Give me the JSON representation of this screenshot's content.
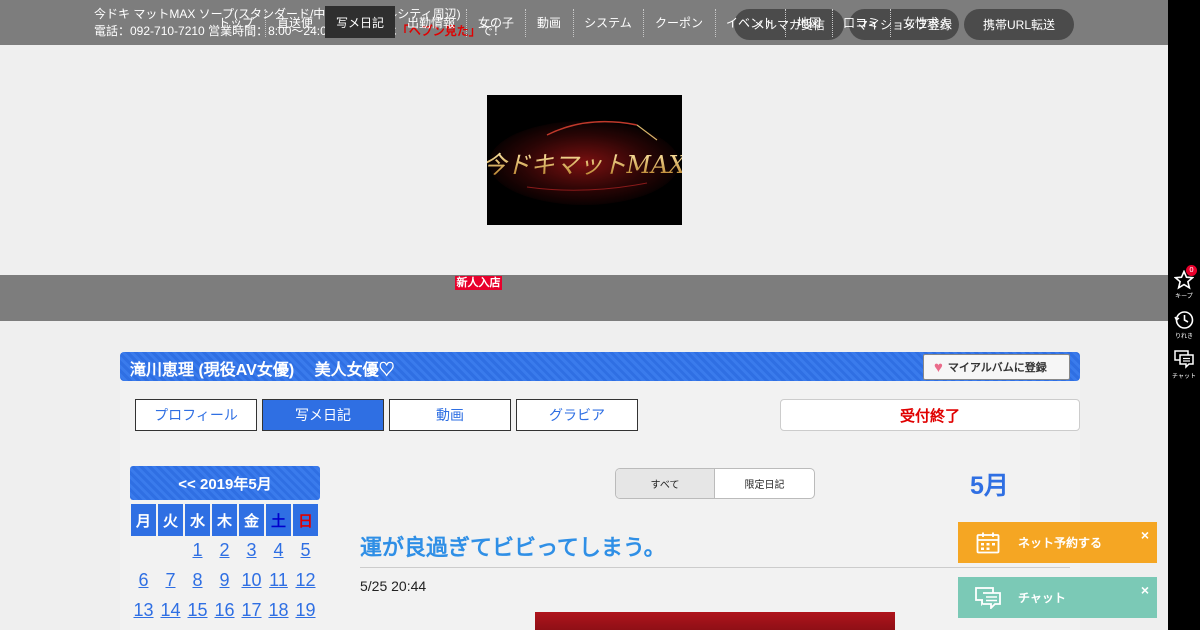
{
  "header": {
    "line1": "今ドキ マットMAX ソープ(スタンダード/中洲・キャナルシティ周辺)",
    "line2_prefix": "電話：092-710-7210 営業時間：8:00～24:00 お問合せは",
    "line2_highlight": "「ヘブン見た」",
    "line2_suffix": "で！",
    "buttons": [
      "メルマガ受信",
      "マイショップ登録",
      "携帯URL転送"
    ]
  },
  "logo": {
    "text": "今ドキマットMAX"
  },
  "nav": {
    "items": [
      "トップ",
      "直送便",
      "写メ日記",
      "出勤情報",
      "女の子",
      "動画",
      "システム",
      "クーポン",
      "イベント",
      "地図",
      "口コミ",
      "女性求人"
    ],
    "active_index": 2,
    "badge": "新人入店"
  },
  "profile": {
    "title": "滝川恵理 (現役AV女優)　 美人女優♡",
    "album_button": "マイアルバムに登録",
    "tabs": [
      "プロフィール",
      "写メ日記",
      "動画",
      "グラビア"
    ],
    "active_tab": 1,
    "status": "受付終了"
  },
  "calendar": {
    "header": "<< 2019年5月",
    "weekdays": [
      "月",
      "火",
      "水",
      "木",
      "金",
      "土",
      "日"
    ],
    "weeks": [
      [
        "",
        "",
        "1",
        "2",
        "3",
        "4",
        "5"
      ],
      [
        "6",
        "7",
        "8",
        "9",
        "10",
        "11",
        "12"
      ],
      [
        "13",
        "14",
        "15",
        "16",
        "17",
        "18",
        "19"
      ]
    ]
  },
  "diary": {
    "filters": [
      "すべて",
      "限定日記"
    ],
    "active_filter": 0,
    "month": "5月",
    "entry_title": "運が良過ぎてビビってしまう。",
    "entry_time": "5/25 20:44"
  },
  "floating": {
    "reserve": "ネット予約する",
    "chat": "チャット",
    "close": "×"
  },
  "rail": {
    "keep_count": "0",
    "items": [
      "キープ",
      "りれき",
      "チャット"
    ]
  },
  "colors": {
    "accent_blue": "#2f6fe3",
    "topbar": "#7d7d7d",
    "alert_red": "#e00000",
    "reserve_orange": "#f5a623",
    "chat_teal": "#7bc9b6"
  }
}
